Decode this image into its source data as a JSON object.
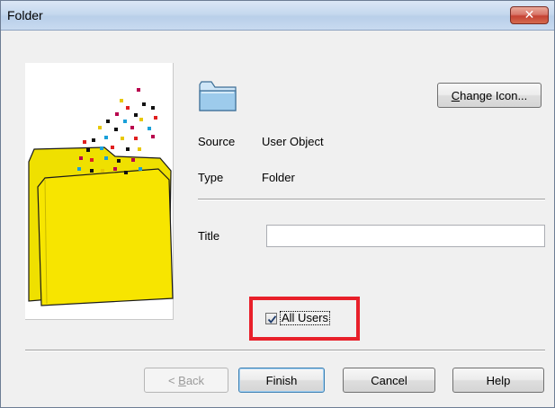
{
  "window": {
    "title": "Folder",
    "close_glyph": "✕"
  },
  "header": {
    "change_icon_prefix": "",
    "change_icon_underlined": "C",
    "change_icon_rest": "hange Icon..."
  },
  "properties": {
    "source_label": "Source",
    "source_value": "User Object",
    "type_label": "Type",
    "type_value": "Folder",
    "title_label": "Title",
    "title_value": ""
  },
  "options": {
    "all_users_label": "All Users",
    "all_users_checked": true
  },
  "footer": {
    "back_prefix": "< ",
    "back_underlined": "B",
    "back_rest": "ack",
    "finish_label": "Finish",
    "cancel_label": "Cancel",
    "help_label": "Help"
  },
  "colors": {
    "highlight": "#e8202a",
    "folder_yellow": "#f5e400",
    "folder_icon_blue": "#a8d4f0"
  },
  "icons": {
    "folder": "folder-icon",
    "wizard_graphic": "folder-pixels-illustration",
    "close": "close-icon",
    "check": "check-icon"
  }
}
